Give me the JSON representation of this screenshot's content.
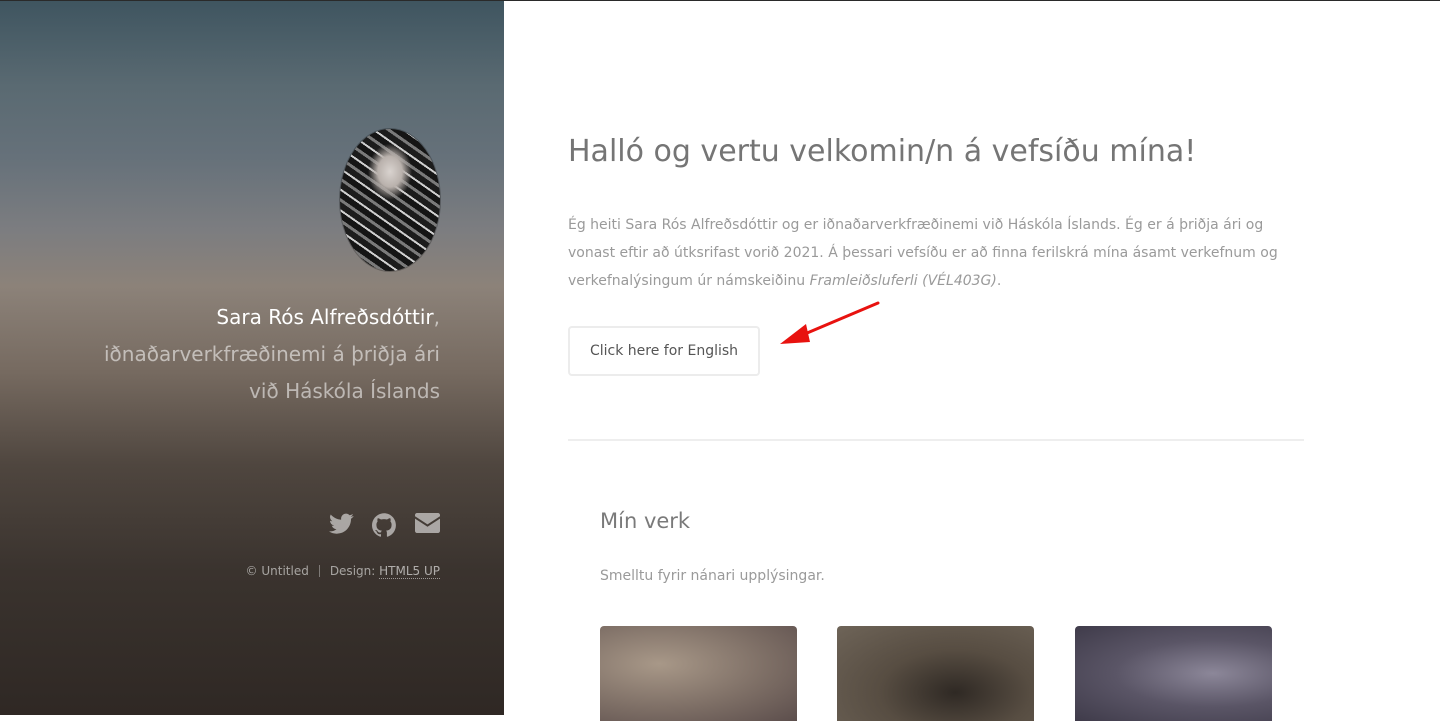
{
  "sidebar": {
    "intro_name": "Sara Rós Alfreðsdóttir",
    "intro_comma": ",",
    "intro_line2": "iðnaðarverkfræðinemi á þriðja ári",
    "intro_line3": "við Háskóla Íslands",
    "social_icons": [
      "twitter-icon",
      "github-icon",
      "envelope-icon"
    ],
    "copyright": "© Untitled",
    "design_label": "Design:",
    "design_link": "HTML5 UP"
  },
  "main": {
    "title": "Halló og vertu velkomin/n á vefsíðu mína!",
    "intro_text": "Ég heiti Sara Rós Alfreðsdóttir og er iðnaðarverkfræðinemi við Háskóla Íslands. Ég er á þriðja ári og vonast eftir að útksrifast vorið 2021. Á þessari vefsíðu er að finna ferilskrá mína ásamt verkefnum og verkefnalýsingum úr námskeiðinu ",
    "course_name": "Framleiðsluferli (VÉL403G)",
    "intro_end": ".",
    "english_button": "Click here for English",
    "works_title": "Mín verk",
    "works_subtitle": "Smelltu fyrir nánari upplýsingar.",
    "annotation_color": "#e8120f"
  },
  "colors": {
    "accent_text": "#757575",
    "body_text": "#9a9a9a"
  }
}
